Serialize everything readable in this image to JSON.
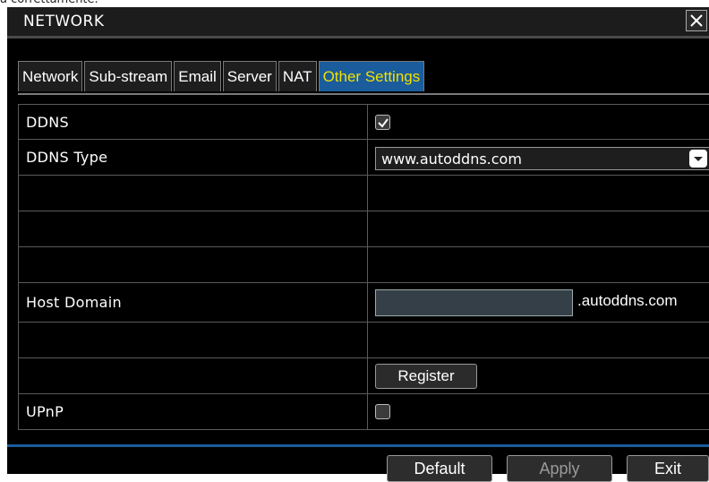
{
  "caption": "a correttamente.",
  "window": {
    "title": "NETWORK"
  },
  "tabs": [
    {
      "label": "Network"
    },
    {
      "label": "Sub-stream"
    },
    {
      "label": "Email"
    },
    {
      "label": "Server"
    },
    {
      "label": "NAT"
    },
    {
      "label": "Other Settings",
      "active": true
    }
  ],
  "rows": {
    "ddns": {
      "label": "DDNS",
      "checked": true
    },
    "ddns_type": {
      "label": "DDNS Type",
      "value": "www.autoddns.com"
    },
    "host_domain": {
      "label": "Host Domain",
      "value": "",
      "suffix": ".autoddns.com"
    },
    "register": {
      "label": "Register"
    },
    "upnp": {
      "label": "UPnP",
      "checked": false
    }
  },
  "buttons": {
    "default": "Default",
    "apply": "Apply",
    "exit": "Exit"
  },
  "colors": {
    "accent": "#1a5c9c",
    "active_tab_text": "#f0e000",
    "background": "#000000"
  }
}
